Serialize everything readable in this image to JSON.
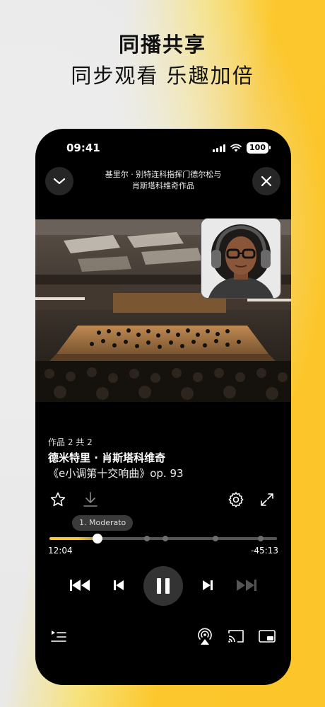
{
  "promo": {
    "title": "同播共享",
    "subtitle": "同步观看 乐趣加倍"
  },
  "status_bar": {
    "time": "09:41",
    "battery": "100",
    "icons": [
      "signal-icon",
      "wifi-icon",
      "battery-icon"
    ]
  },
  "player": {
    "header_title_line1": "基里尔 · 别特连科指挥门德尔松与",
    "header_title_line2": "肖斯塔科维奇作品",
    "work_count": "作品 2 共 2",
    "composer": "德米特里 · 肖斯塔科维奇",
    "work_title": "《e小调第十交响曲》op. 93",
    "movement_tooltip": "1. Moderato",
    "elapsed": "12:04",
    "remaining": "-45:13",
    "progress_fraction": 0.21,
    "movement_markers": [
      0.43,
      0.51,
      0.73,
      0.93
    ],
    "playing": true
  },
  "colors": {
    "accent": "#f6c83a",
    "background_yellow": "#fcc62a",
    "phone_bg": "#000000"
  }
}
